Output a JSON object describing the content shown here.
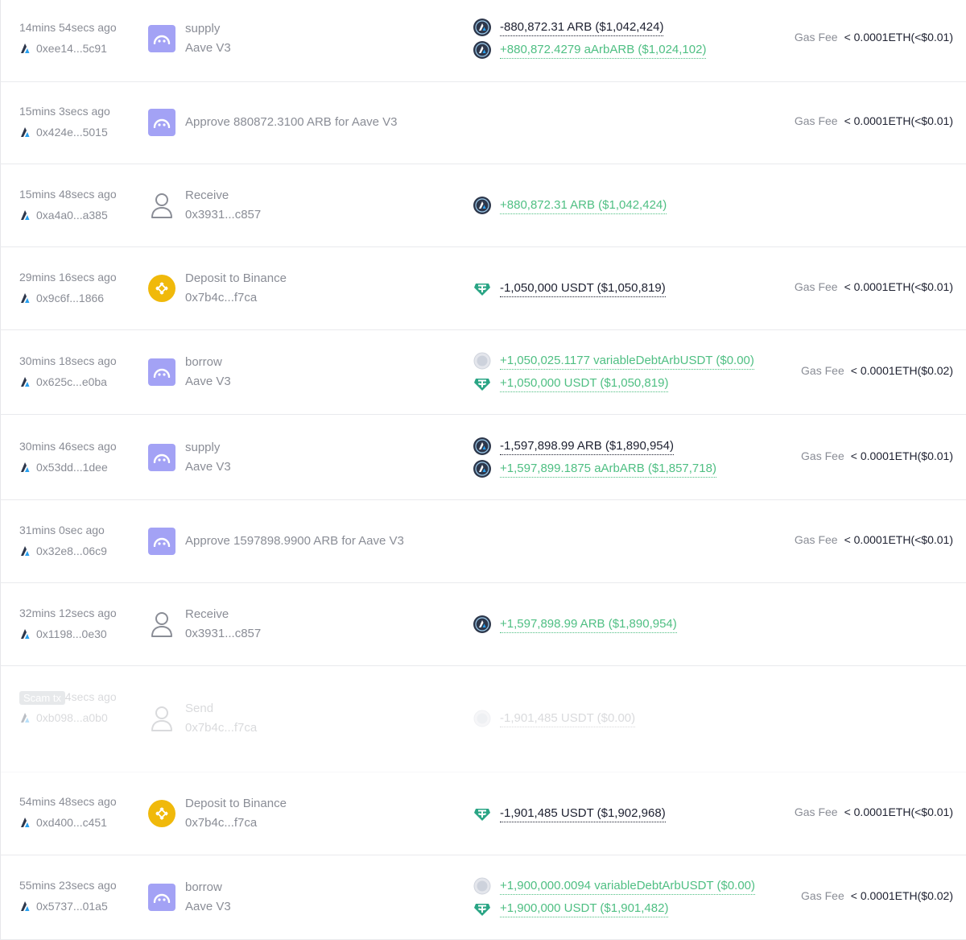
{
  "colors": {
    "negative": "#1d2030",
    "positive": "#4fbf83",
    "muted": "#8a8d96",
    "aave_brand": "#a3a2f5",
    "binance_brand": "#f0b90b",
    "arb_brand": "#2d374b",
    "usdt_brand": "#2aa585"
  },
  "transactions": [
    {
      "time": "14mins 54secs ago",
      "hash": "0xee14...5c91",
      "action_icon": "aave-icon",
      "action": "supply",
      "action_sub": "Aave V3",
      "tokens": [
        {
          "icon": "arbitrum-token-icon",
          "amount": "-880,872.31 ARB ($1,042,424)",
          "sign": "neg"
        },
        {
          "icon": "arbitrum-token-icon",
          "amount": "+880,872.4279 aArbARB ($1,024,102)",
          "sign": "pos"
        }
      ],
      "gas_label": "Gas Fee",
      "gas_value": "< 0.0001ETH(<$0.01)",
      "scam": false
    },
    {
      "time": "15mins 3secs ago",
      "hash": "0x424e...5015",
      "action_icon": "aave-icon",
      "action": "Approve 880872.3100 ARB for Aave V3",
      "action_sub": "",
      "tokens": [],
      "gas_label": "Gas Fee",
      "gas_value": "< 0.0001ETH(<$0.01)",
      "scam": false
    },
    {
      "time": "15mins 48secs ago",
      "hash": "0xa4a0...a385",
      "action_icon": "user-icon",
      "action": "Receive",
      "action_sub": "0x3931...c857",
      "tokens": [
        {
          "icon": "arbitrum-token-icon",
          "amount": "+880,872.31 ARB ($1,042,424)",
          "sign": "pos"
        }
      ],
      "gas_label": "",
      "gas_value": "",
      "scam": false
    },
    {
      "time": "29mins 16secs ago",
      "hash": "0x9c6f...1866",
      "action_icon": "binance-icon",
      "action": "Deposit to Binance",
      "action_sub": "0x7b4c...f7ca",
      "tokens": [
        {
          "icon": "usdt-token-icon",
          "amount": "-1,050,000 USDT ($1,050,819)",
          "sign": "neg"
        }
      ],
      "gas_label": "Gas Fee",
      "gas_value": "< 0.0001ETH(<$0.01)",
      "scam": false
    },
    {
      "time": "30mins 18secs ago",
      "hash": "0x625c...e0ba",
      "action_icon": "aave-icon",
      "action": "borrow",
      "action_sub": "Aave V3",
      "tokens": [
        {
          "icon": "generic-token-icon",
          "amount": "+1,050,025.1177 variableDebtArbUSDT ($0.00)",
          "sign": "pos"
        },
        {
          "icon": "usdt-token-icon",
          "amount": "+1,050,000 USDT ($1,050,819)",
          "sign": "pos"
        }
      ],
      "gas_label": "Gas Fee",
      "gas_value": "< 0.0001ETH($0.02)",
      "scam": false
    },
    {
      "time": "30mins 46secs ago",
      "hash": "0x53dd...1dee",
      "action_icon": "aave-icon",
      "action": "supply",
      "action_sub": "Aave V3",
      "tokens": [
        {
          "icon": "arbitrum-token-icon",
          "amount": "-1,597,898.99 ARB ($1,890,954)",
          "sign": "neg"
        },
        {
          "icon": "arbitrum-token-icon",
          "amount": "+1,597,899.1875 aArbARB ($1,857,718)",
          "sign": "pos"
        }
      ],
      "gas_label": "Gas Fee",
      "gas_value": "< 0.0001ETH($0.01)",
      "scam": false
    },
    {
      "time": "31mins 0sec ago",
      "hash": "0x32e8...06c9",
      "action_icon": "aave-icon",
      "action": "Approve 1597898.9900 ARB for Aave V3",
      "action_sub": "",
      "tokens": [],
      "gas_label": "Gas Fee",
      "gas_value": "< 0.0001ETH(<$0.01)",
      "scam": false
    },
    {
      "time": "32mins 12secs ago",
      "hash": "0x1198...0e30",
      "action_icon": "user-icon",
      "action": "Receive",
      "action_sub": "0x3931...c857",
      "tokens": [
        {
          "icon": "arbitrum-token-icon",
          "amount": "+1,597,898.99 ARB ($1,890,954)",
          "sign": "pos"
        }
      ],
      "gas_label": "",
      "gas_value": "",
      "scam": false
    },
    {
      "scam_label": "Scam tx",
      "time": "52mins 14secs ago",
      "hash": "0xb098...a0b0",
      "action_icon": "user-icon",
      "action": "Send",
      "action_sub": "0x7b4c...f7ca",
      "tokens": [
        {
          "icon": "generic-token-icon",
          "amount": "-1,901,485 USDT ($0.00)",
          "sign": "faded"
        }
      ],
      "gas_label": "",
      "gas_value": "",
      "scam": true
    },
    {
      "time": "54mins 48secs ago",
      "hash": "0xd400...c451",
      "action_icon": "binance-icon",
      "action": "Deposit to Binance",
      "action_sub": "0x7b4c...f7ca",
      "tokens": [
        {
          "icon": "usdt-token-icon",
          "amount": "-1,901,485 USDT ($1,902,968)",
          "sign": "neg"
        }
      ],
      "gas_label": "Gas Fee",
      "gas_value": "< 0.0001ETH(<$0.01)",
      "scam": false
    },
    {
      "time": "55mins 23secs ago",
      "hash": "0x5737...01a5",
      "action_icon": "aave-icon",
      "action": "borrow",
      "action_sub": "Aave V3",
      "tokens": [
        {
          "icon": "generic-token-icon",
          "amount": "+1,900,000.0094 variableDebtArbUSDT ($0.00)",
          "sign": "pos"
        },
        {
          "icon": "usdt-token-icon",
          "amount": "+1,900,000 USDT ($1,901,482)",
          "sign": "pos"
        }
      ],
      "gas_label": "Gas Fee",
      "gas_value": "< 0.0001ETH($0.02)",
      "scam": false
    }
  ]
}
